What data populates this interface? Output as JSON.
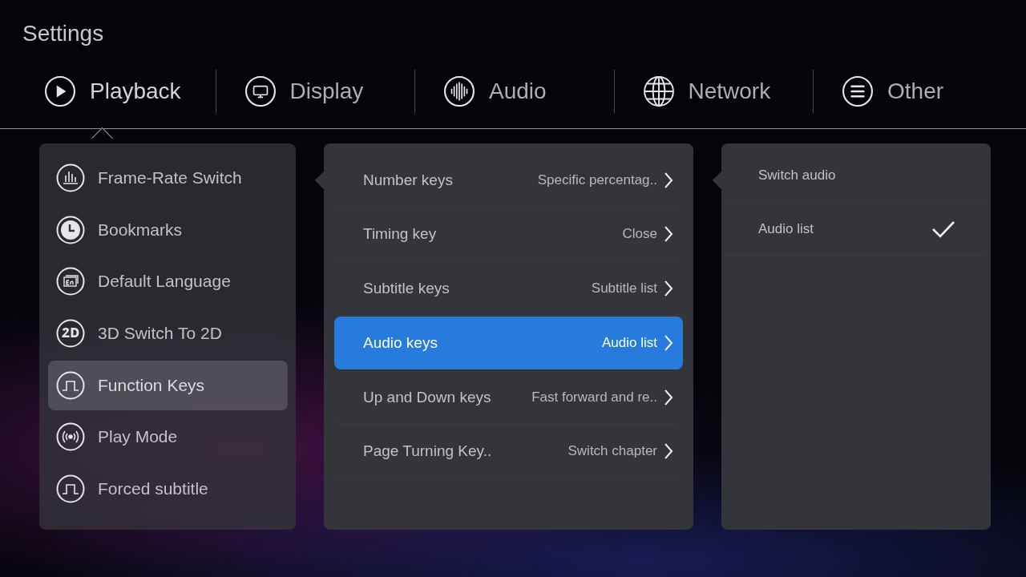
{
  "title": "Settings",
  "tabs": [
    {
      "label": "Playback",
      "kind": "play",
      "selected": true
    },
    {
      "label": "Display",
      "kind": "monitor",
      "selected": false
    },
    {
      "label": "Audio",
      "kind": "wave",
      "selected": false
    },
    {
      "label": "Network",
      "kind": "globe",
      "selected": false
    },
    {
      "label": "Other",
      "kind": "list",
      "selected": false
    }
  ],
  "menu": [
    {
      "label": "Frame-Rate Switch",
      "kind": "bars",
      "selected": false
    },
    {
      "label": "Bookmarks",
      "kind": "clock",
      "selected": false
    },
    {
      "label": "Default Language",
      "kind": "lang",
      "selected": false
    },
    {
      "label": "3D Switch To 2D",
      "kind": "flat",
      "selected": false
    },
    {
      "label": "Function Keys",
      "kind": "pulse",
      "selected": true
    },
    {
      "label": "Play Mode",
      "kind": "broadcast",
      "selected": false
    },
    {
      "label": "Forced subtitle",
      "kind": "pulse",
      "selected": false
    }
  ],
  "keys": [
    {
      "label": "Number keys",
      "value": "Specific percentag..",
      "selected": false
    },
    {
      "label": "Timing key",
      "value": "Close",
      "selected": false
    },
    {
      "label": "Subtitle keys",
      "value": "Subtitle list",
      "selected": false
    },
    {
      "label": "Audio keys",
      "value": "Audio list",
      "selected": true
    },
    {
      "label": "Up and Down keys",
      "value": "Fast forward and re..",
      "selected": false
    },
    {
      "label": "Page Turning Key..",
      "value": "Switch chapter",
      "selected": false
    }
  ],
  "options": [
    {
      "label": "Switch audio",
      "checked": false
    },
    {
      "label": "Audio list",
      "checked": true
    }
  ]
}
